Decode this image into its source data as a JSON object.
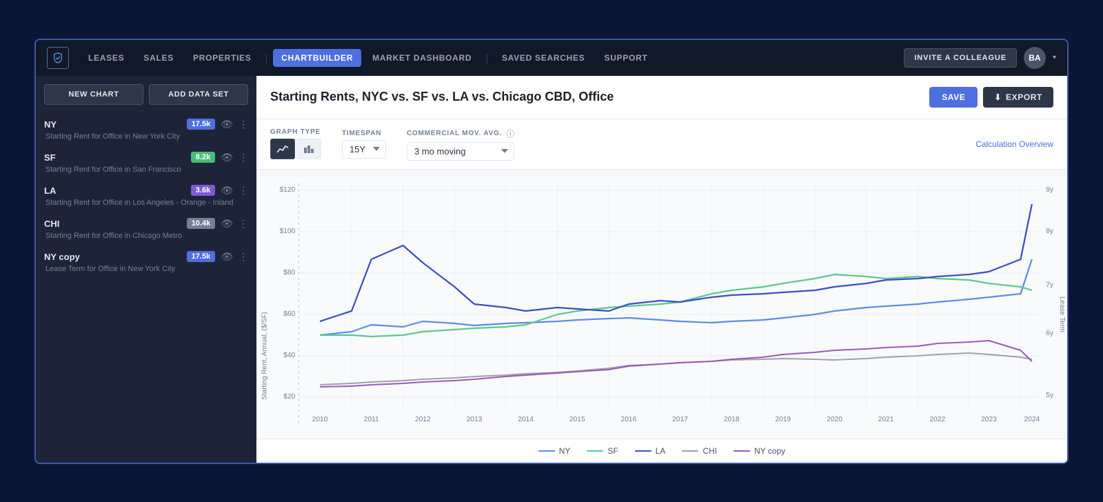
{
  "nav": {
    "logo_alt": "CompStak",
    "links": [
      {
        "label": "LEASES",
        "active": false
      },
      {
        "label": "SALES",
        "active": false
      },
      {
        "label": "PROPERTIES",
        "active": false
      },
      {
        "label": "CHARTBUILDER",
        "active": true
      },
      {
        "label": "MARKET DASHBOARD",
        "active": false
      },
      {
        "label": "SAVED SEARCHES",
        "active": false
      },
      {
        "label": "SUPPORT",
        "active": false
      }
    ],
    "invite_btn": "INVITE A COLLEAGUE",
    "avatar": "BA"
  },
  "sidebar": {
    "new_chart_label": "NEW CHART",
    "add_dataset_label": "ADD DATA SET",
    "datasets": [
      {
        "name": "NY",
        "badge": "17.5k",
        "badge_color": "badge-blue",
        "desc": "Starting Rent for Office in New York City"
      },
      {
        "name": "SF",
        "badge": "8.2k",
        "badge_color": "badge-green",
        "desc": "Starting Rent for Office in San Francisco"
      },
      {
        "name": "LA",
        "badge": "3.6k",
        "badge_color": "badge-purple",
        "desc": "Starting Rent for Office in Los Angeles - Orange - Inland"
      },
      {
        "name": "CHI",
        "badge": "10.4k",
        "badge_color": "badge-gray",
        "desc": "Starting Rent for Office in Chicago Metro"
      },
      {
        "name": "NY copy",
        "badge": "17.5k",
        "badge_color": "badge-blue",
        "desc": "Lease Term for Office in New York City"
      }
    ]
  },
  "chart": {
    "title": "Starting Rents, NYC vs. SF vs. LA vs. Chicago CBD, Office",
    "save_label": "SAVE",
    "export_label": "EXPORT",
    "controls": {
      "graph_type_label": "GRAPH TYPE",
      "timespan_label": "TIMESPAN",
      "timespan_value": "15Y",
      "mov_avg_label": "COMMERCIAL MOV. AVG.",
      "mov_avg_value": "3 mo moving",
      "calc_link": "Calculation Overview"
    },
    "y_axis_label": "Starting Rent, Annual, ($/SF)",
    "y_axis_right_label": "Lease Term",
    "y_ticks": [
      "$120",
      "$100",
      "$80",
      "$60",
      "$40",
      "$20"
    ],
    "x_ticks": [
      "2010",
      "2011",
      "2012",
      "2013",
      "2014",
      "2015",
      "2016",
      "2017",
      "2018",
      "2019",
      "2020",
      "2021",
      "2022",
      "2023",
      "2024"
    ],
    "right_ticks": [
      "9y",
      "8y",
      "7y",
      "6y",
      "5y"
    ],
    "legend": [
      {
        "label": "NY",
        "color": "#5b8ce8"
      },
      {
        "label": "SF",
        "color": "#5bc88e"
      },
      {
        "label": "LA",
        "color": "#3a4fc4"
      },
      {
        "label": "CHI",
        "color": "#a0a0a8"
      },
      {
        "label": "NY copy",
        "color": "#9b59b6"
      }
    ]
  }
}
